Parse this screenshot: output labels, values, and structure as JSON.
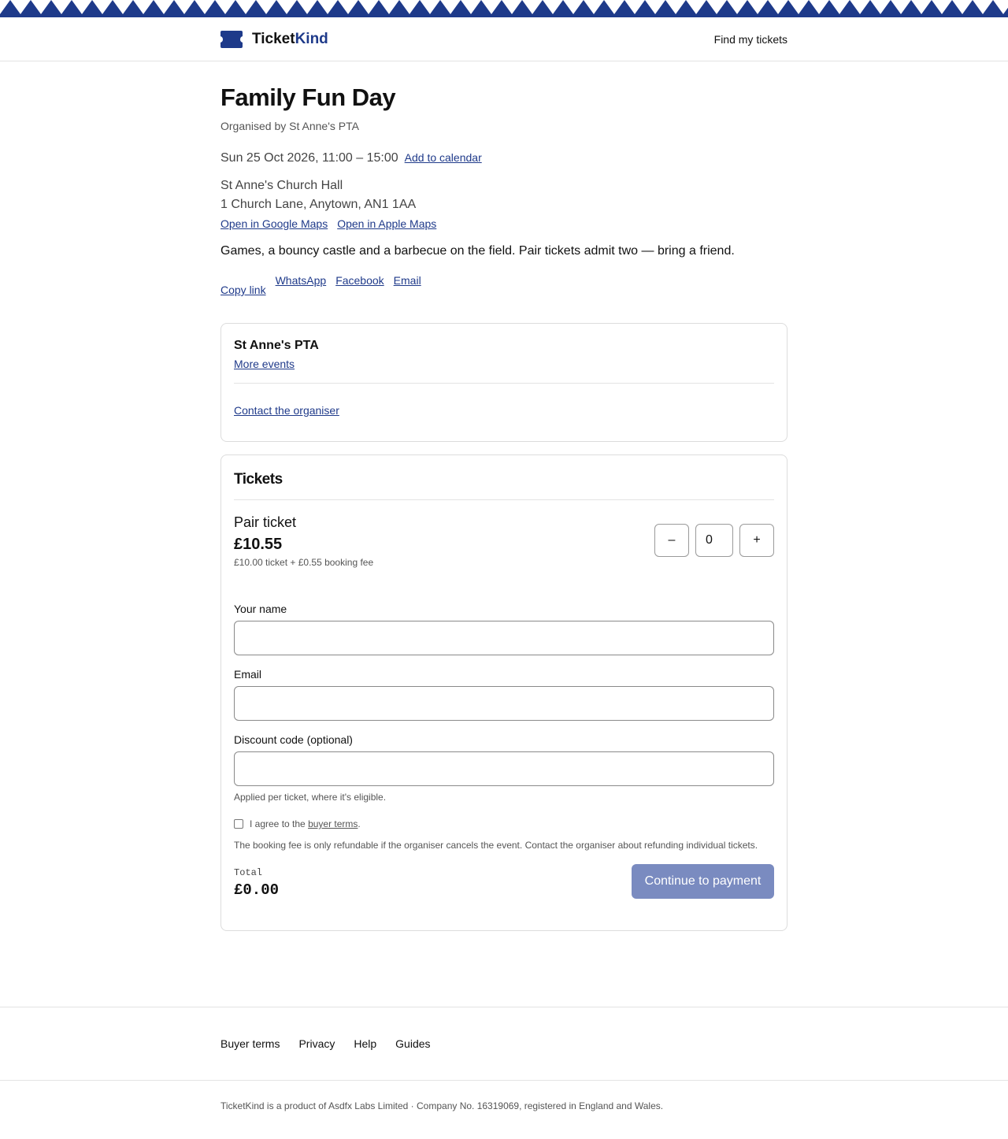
{
  "brand": {
    "name_part1": "Ticket",
    "name_part2": "Kind",
    "accent": "#1e3a8a"
  },
  "header": {
    "find_tickets": "Find my tickets"
  },
  "event": {
    "title": "Family Fun Day",
    "organised_by": "Organised by St Anne's PTA",
    "datetime": "Sun 25 Oct 2026, 11:00 – 15:00",
    "add_to_calendar": "Add to calendar",
    "venue_name": "St Anne's Church Hall",
    "venue_address": "1 Church Lane, Anytown, AN1 1AA",
    "google_maps": "Open in Google Maps",
    "apple_maps": "Open in Apple Maps",
    "description": "Games, a bouncy castle and a barbecue on the field. Pair tickets admit two — bring a friend."
  },
  "share": {
    "copy_link": "Copy link",
    "whatsapp": "WhatsApp",
    "facebook": "Facebook",
    "email": "Email"
  },
  "organiser_card": {
    "name": "St Anne's PTA",
    "more_events": "More events",
    "contact": "Contact the organiser"
  },
  "tickets": {
    "heading": "Tickets",
    "items": [
      {
        "name": "Pair ticket",
        "price": "£10.55",
        "breakdown": "£10.00 ticket + £0.55 booking fee",
        "quantity": "0",
        "minus": "–",
        "plus": "+"
      }
    ]
  },
  "form": {
    "name_label": "Your name",
    "email_label": "Email",
    "discount_label": "Discount code (optional)",
    "discount_help": "Applied per ticket, where it's eligible.",
    "terms_prefix": "I agree to the ",
    "terms_link": "buyer terms",
    "terms_suffix": ".",
    "refund_note": "The booking fee is only refundable if the organiser cancels the event. Contact the organiser about refunding individual tickets."
  },
  "checkout": {
    "total_label": "Total",
    "total_value": "£0.00",
    "continue": "Continue to payment"
  },
  "footer": {
    "links": [
      "Buyer terms",
      "Privacy",
      "Help",
      "Guides"
    ],
    "legal": "TicketKind is a product of Asdfx Labs Limited · Company No. 16319069, registered in England and Wales."
  }
}
